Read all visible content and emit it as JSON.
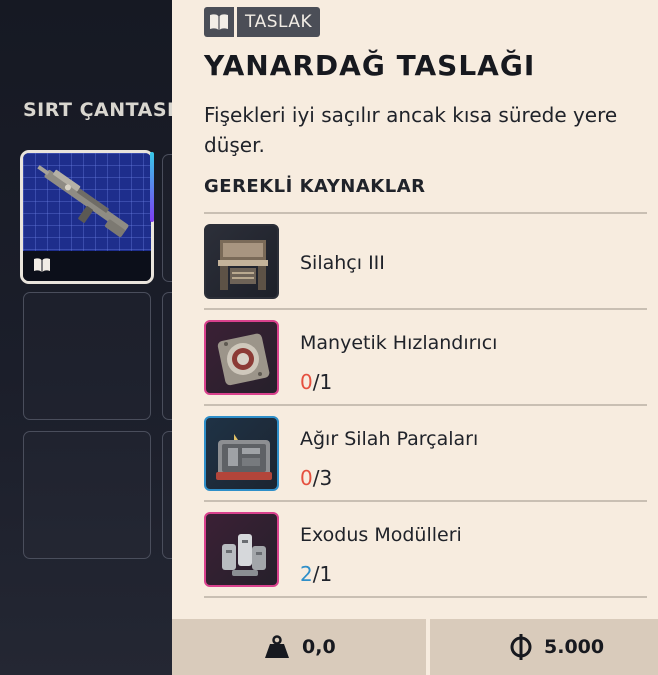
{
  "backpack": {
    "title": "SIRT ÇANTASI"
  },
  "item": {
    "type_label": "TASLAK",
    "title": "YANARDAĞ TASLAĞI",
    "description": "Fişekleri iyi saçılır ancak kısa sürede yere düşer."
  },
  "requirements": {
    "header": "GEREKLİ KAYNAKLAR",
    "items": [
      {
        "name": "Silahçı III",
        "icon": "workbench-icon",
        "rarity": "common"
      },
      {
        "name": "Manyetik Hızlandırıcı",
        "have": "0",
        "need": "/1",
        "have_color": "#e5503f",
        "icon": "magnetic-accelerator-icon",
        "rarity": "epic"
      },
      {
        "name": "Ağır Silah Parçaları",
        "have": "0",
        "need": "/3",
        "have_color": "#e5503f",
        "icon": "weapon-parts-case-icon",
        "rarity": "rare"
      },
      {
        "name": "Exodus Modülleri",
        "have": "2",
        "need": "/1",
        "have_color": "#2f8fc9",
        "icon": "exodus-modules-icon",
        "rarity": "epic"
      }
    ]
  },
  "footer": {
    "weight": "0,0",
    "price": "5.000"
  },
  "colors": {
    "panel_bg": "#f7ecdf",
    "footer_bg": "#d9cbbb",
    "missing": "#e5503f",
    "owned": "#2f8fc9",
    "epic": "#d9418d",
    "rare": "#2f8fc9"
  }
}
